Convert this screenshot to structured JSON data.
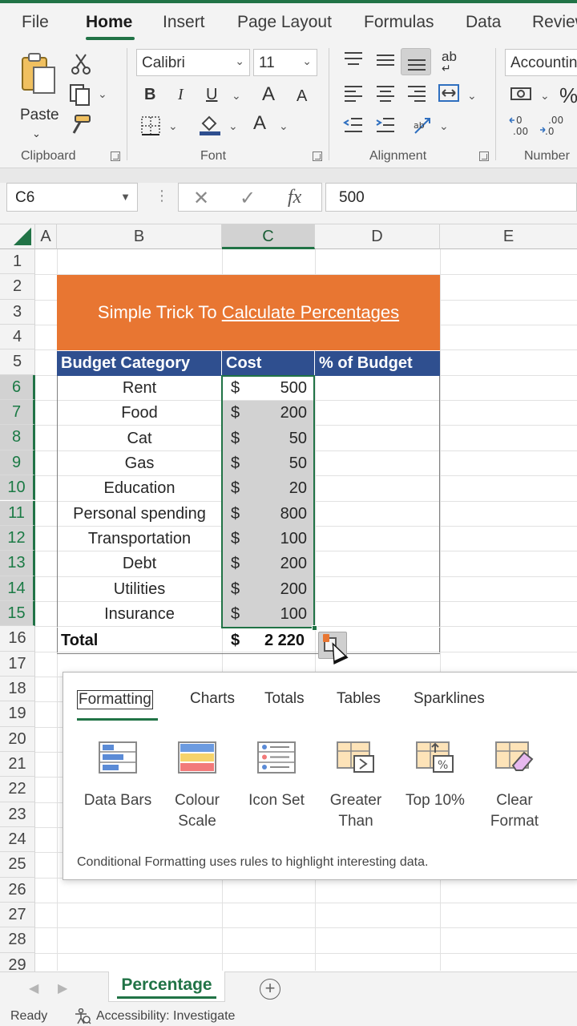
{
  "menu": {
    "tabs": [
      {
        "label": "File",
        "active": false
      },
      {
        "label": "Home",
        "active": true
      },
      {
        "label": "Insert",
        "active": false
      },
      {
        "label": "Page Layout",
        "active": false
      },
      {
        "label": "Formulas",
        "active": false
      },
      {
        "label": "Data",
        "active": false
      },
      {
        "label": "Review",
        "active": false
      }
    ]
  },
  "ribbon": {
    "clipboard": {
      "paste_label": "Paste",
      "group_label": "Clipboard"
    },
    "font": {
      "font_name": "Calibri",
      "font_size": "11",
      "bold": "B",
      "italic": "I",
      "underline": "U",
      "grow": "A",
      "shrink": "A",
      "color_a": "A",
      "group_label": "Font"
    },
    "alignment": {
      "group_label": "Alignment",
      "wrap_label": "ab"
    },
    "number": {
      "format": "Accounting",
      "percent": "%",
      "group_label": "Number"
    }
  },
  "formula_bar": {
    "name_box": "C6",
    "fx": "fx",
    "cancel": "✕",
    "enter": "✓",
    "value": "500"
  },
  "grid": {
    "columns": [
      "A",
      "B",
      "C",
      "D",
      "E"
    ],
    "selected_column": "C",
    "rows": [
      "1",
      "2",
      "3",
      "4",
      "5",
      "6",
      "7",
      "8",
      "9",
      "10",
      "11",
      "12",
      "13",
      "14",
      "15",
      "16",
      "17",
      "18",
      "19",
      "20",
      "21",
      "22",
      "23",
      "24",
      "25",
      "26",
      "27",
      "28",
      "29"
    ],
    "selected_rows": [
      "6",
      "7",
      "8",
      "9",
      "10",
      "11",
      "12",
      "13",
      "14",
      "15"
    ],
    "title_part1": "Simple Trick To ",
    "title_part2": "Calculate Percentages",
    "headers": [
      "Budget Category",
      "Cost",
      "% of Budget"
    ],
    "items": [
      {
        "category": "Rent",
        "currency": "$",
        "cost": "500"
      },
      {
        "category": "Food",
        "currency": "$",
        "cost": "200"
      },
      {
        "category": "Cat",
        "currency": "$",
        "cost": "50"
      },
      {
        "category": "Gas",
        "currency": "$",
        "cost": "50"
      },
      {
        "category": "Education",
        "currency": "$",
        "cost": "20"
      },
      {
        "category": "Personal spending",
        "currency": "$",
        "cost": "800"
      },
      {
        "category": "Transportation",
        "currency": "$",
        "cost": "100"
      },
      {
        "category": "Debt",
        "currency": "$",
        "cost": "200"
      },
      {
        "category": "Utilities",
        "currency": "$",
        "cost": "200"
      },
      {
        "category": "Insurance",
        "currency": "$",
        "cost": "100"
      }
    ],
    "total": {
      "label": "Total",
      "currency": "$",
      "value": "2 220"
    }
  },
  "quick_analysis": {
    "tabs": [
      {
        "label": "Formatting",
        "active": true
      },
      {
        "label": "Charts",
        "active": false
      },
      {
        "label": "Totals",
        "active": false
      },
      {
        "label": "Tables",
        "active": false
      },
      {
        "label": "Sparklines",
        "active": false
      }
    ],
    "items": [
      {
        "label_line1": "Data Bars",
        "label_line2": "",
        "icon": "data-bars-icon"
      },
      {
        "label_line1": "Colour",
        "label_line2": "Scale",
        "icon": "colour-scale-icon"
      },
      {
        "label_line1": "Icon Set",
        "label_line2": "",
        "icon": "icon-set-icon"
      },
      {
        "label_line1": "Greater",
        "label_line2": "Than",
        "icon": "greater-than-icon"
      },
      {
        "label_line1": "Top 10%",
        "label_line2": "",
        "icon": "top-10-icon"
      },
      {
        "label_line1": "Clear",
        "label_line2": "Format",
        "icon": "clear-format-icon"
      }
    ],
    "description": "Conditional Formatting uses rules to highlight interesting data."
  },
  "sheets": {
    "tabs": [
      {
        "label": "Percentage",
        "active": true
      }
    ]
  },
  "status": {
    "ready": "Ready",
    "accessibility": "Accessibility: Investigate"
  },
  "colors": {
    "excel_green": "#217346",
    "title_orange": "#e87632",
    "header_blue": "#2f4f8f",
    "selection_gray": "#d2d2d2"
  }
}
